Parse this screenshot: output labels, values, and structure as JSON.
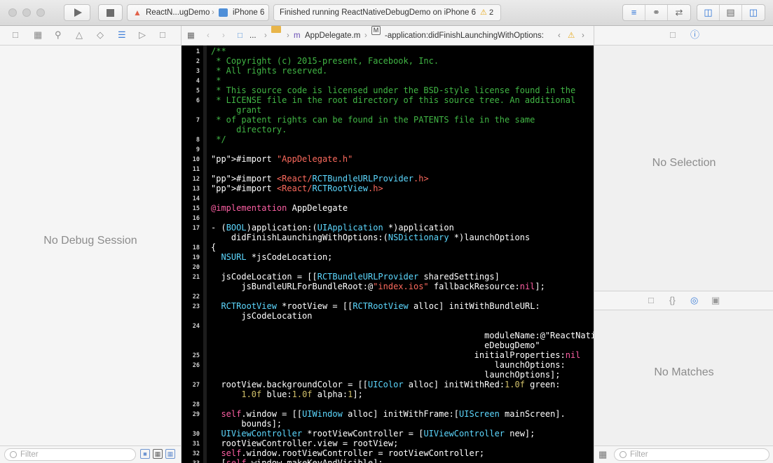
{
  "window": {
    "scheme_app": "ReactN...ugDemo",
    "scheme_device": "iPhone 6",
    "activity": "Finished running ReactNativeDebugDemo on iPhone 6",
    "warning_count": "2"
  },
  "jumpbar": {
    "ellipsis": "...",
    "file": "AppDelegate.m",
    "method_badge": "M",
    "method": "-application:didFinishLaunchingWithOptions:"
  },
  "debug": {
    "empty": "No Debug Session",
    "filter_placeholder": "Filter"
  },
  "inspector": {
    "empty": "No Selection",
    "library_empty": "No Matches",
    "filter_placeholder": "Filter"
  },
  "editor": {
    "lines": [
      {
        "n": "1",
        "t": "/**"
      },
      {
        "n": "2",
        "t": " * Copyright (c) 2015-present, Facebook, Inc."
      },
      {
        "n": "3",
        "t": " * All rights reserved."
      },
      {
        "n": "4",
        "t": " *"
      },
      {
        "n": "5",
        "t": " * This source code is licensed under the BSD-style license found in the"
      },
      {
        "n": "6",
        "t": " * LICENSE file in the root directory of this source tree. An additional\n     grant"
      },
      {
        "n": "7",
        "t": " * of patent rights can be found in the PATENTS file in the same\n     directory."
      },
      {
        "n": "8",
        "t": " */"
      },
      {
        "n": "9",
        "t": ""
      },
      {
        "n": "10",
        "t": "#import \"AppDelegate.h\""
      },
      {
        "n": "11",
        "t": ""
      },
      {
        "n": "12",
        "t": "#import <React/RCTBundleURLProvider.h>"
      },
      {
        "n": "13",
        "t": "#import <React/RCTRootView.h>"
      },
      {
        "n": "14",
        "t": ""
      },
      {
        "n": "15",
        "t": "@implementation AppDelegate"
      },
      {
        "n": "16",
        "t": ""
      },
      {
        "n": "17",
        "t": "- (BOOL)application:(UIApplication *)application\n    didFinishLaunchingWithOptions:(NSDictionary *)launchOptions"
      },
      {
        "n": "18",
        "t": "{"
      },
      {
        "n": "19",
        "t": "  NSURL *jsCodeLocation;"
      },
      {
        "n": "20",
        "t": ""
      },
      {
        "n": "21",
        "t": "  jsCodeLocation = [[RCTBundleURLProvider sharedSettings]\n      jsBundleURLForBundleRoot:@\"index.ios\" fallbackResource:nil];"
      },
      {
        "n": "22",
        "t": ""
      },
      {
        "n": "23",
        "t": "  RCTRootView *rootView = [[RCTRootView alloc] initWithBundleURL:\n      jsCodeLocation"
      },
      {
        "n": "24",
        "t": "\n                                                      moduleName:@\"ReactNativ\n                                                      eDebugDemo\""
      },
      {
        "n": "25",
        "t": "                                                    initialProperties:nil"
      },
      {
        "n": "26",
        "t": "                                                        launchOptions:\n                                                      launchOptions];"
      },
      {
        "n": "27",
        "t": "  rootView.backgroundColor = [[UIColor alloc] initWithRed:1.0f green:\n      1.0f blue:1.0f alpha:1];"
      },
      {
        "n": "28",
        "t": ""
      },
      {
        "n": "29",
        "t": "  self.window = [[UIWindow alloc] initWithFrame:[UIScreen mainScreen].\n      bounds];"
      },
      {
        "n": "30",
        "t": "  UIViewController *rootViewController = [UIViewController new];"
      },
      {
        "n": "31",
        "t": "  rootViewController.view = rootView;"
      },
      {
        "n": "32",
        "t": "  self.window.rootViewController = rootViewController;"
      },
      {
        "n": "33",
        "t": "  [self.window makeKeyAndVisible];"
      }
    ]
  }
}
